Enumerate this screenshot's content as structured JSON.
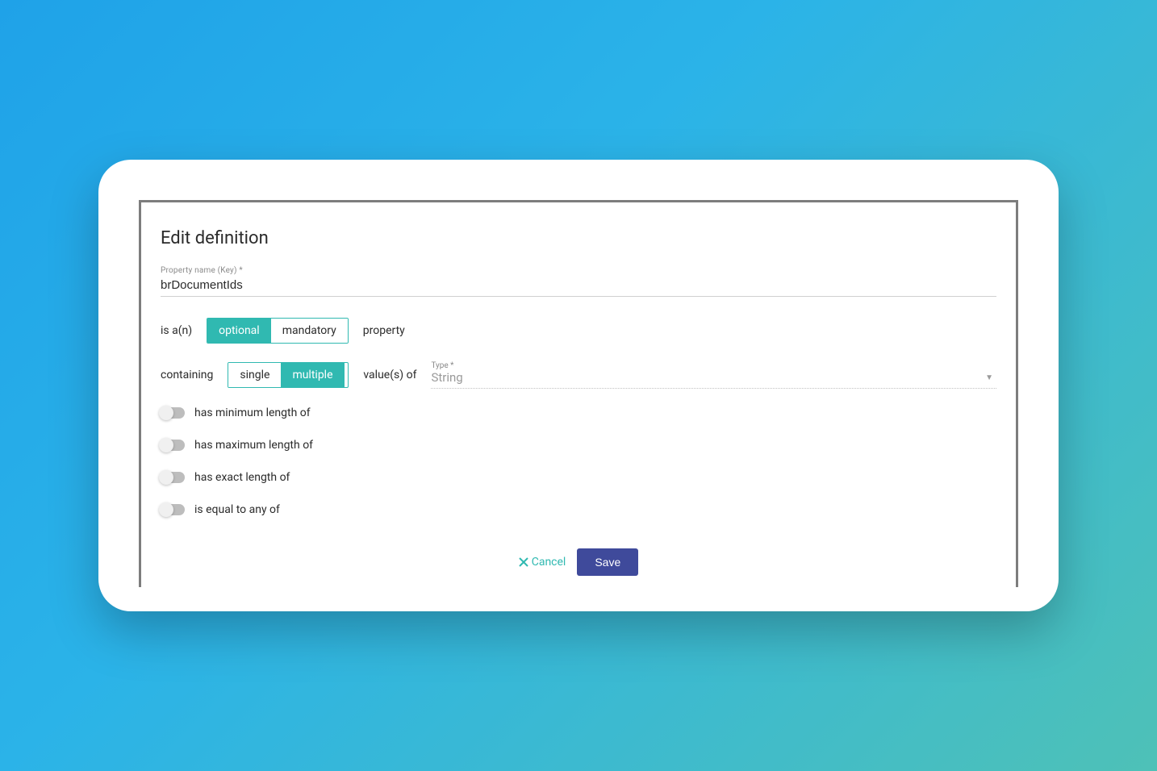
{
  "dialog": {
    "title": "Edit definition",
    "propertyName": {
      "label": "Property name (Key) *",
      "value": "brDocumentIds"
    },
    "line1": {
      "prefix": "is a(n)",
      "options": {
        "optional": "optional",
        "mandatory": "mandatory"
      },
      "selected": "optional",
      "suffix": "property"
    },
    "line2": {
      "prefix": "containing",
      "options": {
        "single": "single",
        "multiple": "multiple"
      },
      "selected": "multiple",
      "mid": "value(s) of",
      "typeLabel": "Type *",
      "typeValue": "String"
    },
    "constraints": [
      {
        "label": "has minimum length of",
        "enabled": false
      },
      {
        "label": "has maximum length of",
        "enabled": false
      },
      {
        "label": "has exact length of",
        "enabled": false
      },
      {
        "label": "is equal to any of",
        "enabled": false
      }
    ],
    "actions": {
      "cancel": "Cancel",
      "save": "Save"
    }
  }
}
